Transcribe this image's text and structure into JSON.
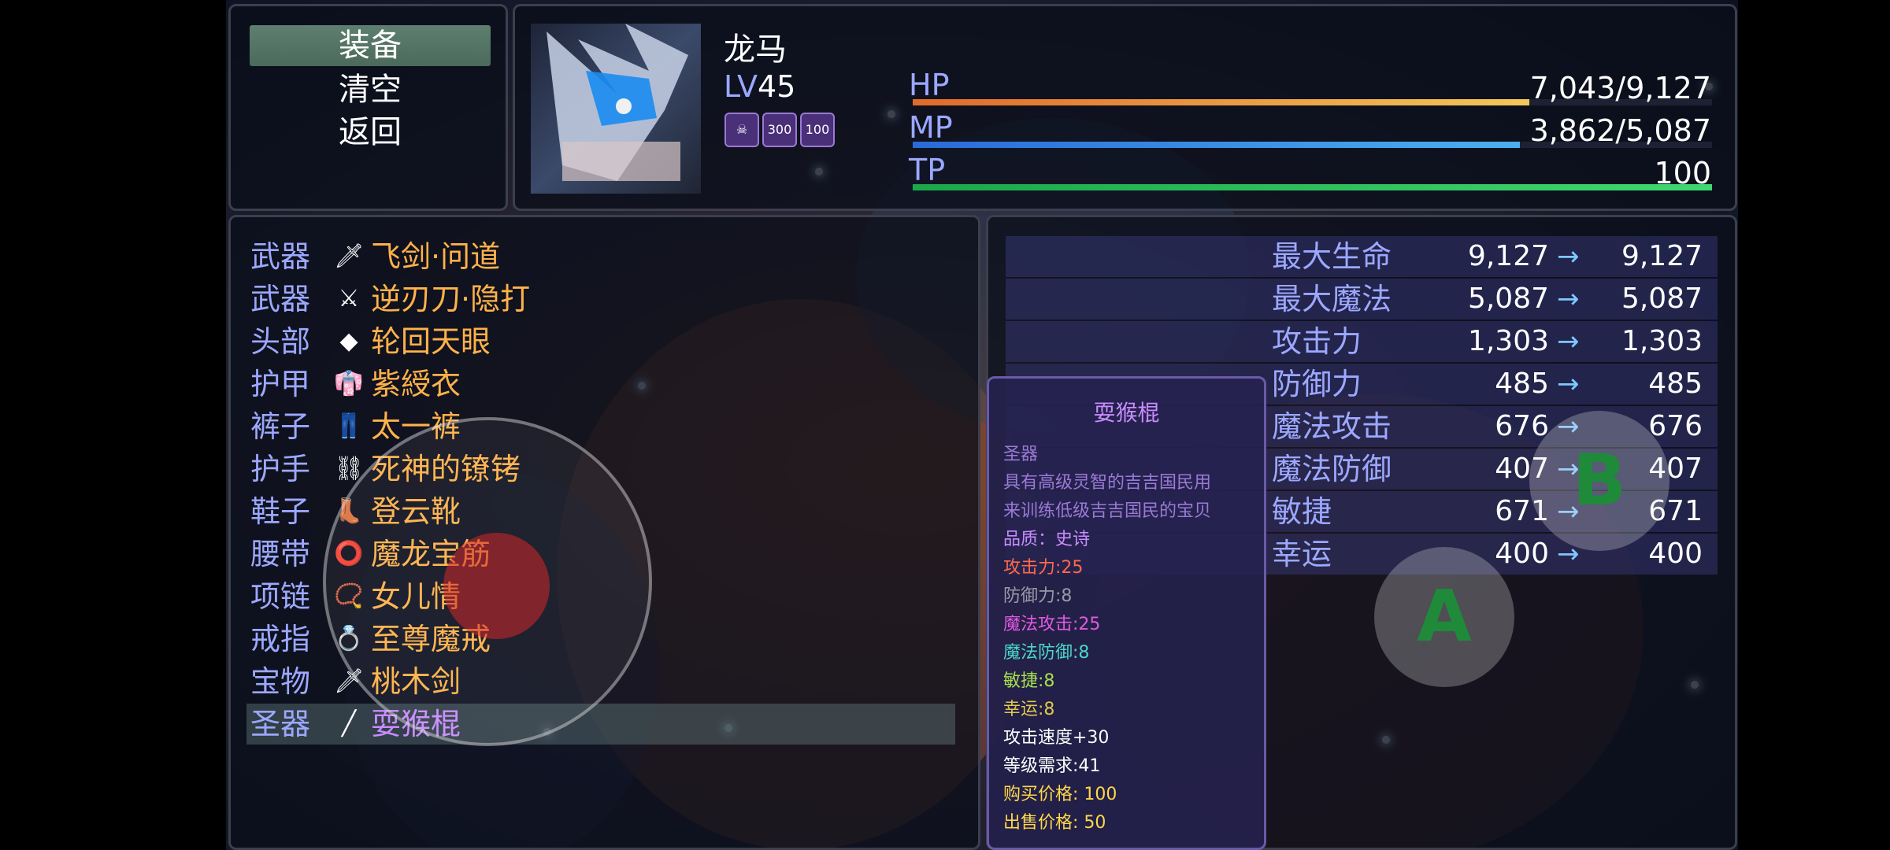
{
  "menu": {
    "items": [
      "装备",
      "清空",
      "返回"
    ],
    "selected_index": 0
  },
  "actor": {
    "name": "龙马",
    "level_prefix": "LV",
    "level": "45",
    "state_icons": [
      {
        "icon": "fang-mouth-icon",
        "text": ""
      },
      {
        "icon": "skull-300-icon",
        "text": "300"
      },
      {
        "icon": "shield-100-icon",
        "text": "100"
      }
    ],
    "gauges": [
      {
        "label": "HP",
        "value": "7,043/9,127",
        "fill": 0.7717,
        "color_from": "#e06a2a",
        "color_to": "#f2c85a"
      },
      {
        "label": "MP",
        "value": "3,862/5,087",
        "fill": 0.7592,
        "color_from": "#2a6ad8",
        "color_to": "#4ab0f0"
      },
      {
        "label": "TP",
        "value": "100",
        "fill": 1.0,
        "color_from": "#1aa84a",
        "color_to": "#3ed870"
      }
    ]
  },
  "slots": [
    {
      "type": "武器",
      "icon": "flying-sword-icon",
      "glyph": "🗡",
      "item": "飞剑·问道"
    },
    {
      "type": "武器",
      "icon": "reverse-blade-icon",
      "glyph": "⚔",
      "item": "逆刃刀·隐打"
    },
    {
      "type": "头部",
      "icon": "eye-gem-icon",
      "glyph": "◆",
      "item": "轮回天眼"
    },
    {
      "type": "护甲",
      "icon": "robe-icon",
      "glyph": "👘",
      "item": "紫綬衣"
    },
    {
      "type": "裤子",
      "icon": "pants-icon",
      "glyph": "👖",
      "item": "太一裤"
    },
    {
      "type": "护手",
      "icon": "shackles-icon",
      "glyph": "⛓",
      "item": "死神的镣铐"
    },
    {
      "type": "鞋子",
      "icon": "boot-icon",
      "glyph": "👢",
      "item": "登云靴"
    },
    {
      "type": "腰带",
      "icon": "belt-icon",
      "glyph": "⭕",
      "item": "魔龙宝筋"
    },
    {
      "type": "项链",
      "icon": "necklace-icon",
      "glyph": "📿",
      "item": "女儿情"
    },
    {
      "type": "戒指",
      "icon": "ring-icon",
      "glyph": "💍",
      "item": "至尊魔戒"
    },
    {
      "type": "宝物",
      "icon": "peach-sword-icon",
      "glyph": "🗡",
      "item": "桃木剑"
    },
    {
      "type": "圣器",
      "icon": "staff-icon",
      "glyph": "╱",
      "item": "耍猴棍"
    }
  ],
  "selected_slot": 11,
  "params": [
    {
      "name": "最大生命",
      "current": "9,127",
      "new": "9,127"
    },
    {
      "name": "最大魔法",
      "current": "5,087",
      "new": "5,087"
    },
    {
      "name": "攻击力",
      "current": "1,303",
      "new": "1,303"
    },
    {
      "name": "防御力",
      "current": "485",
      "new": "485"
    },
    {
      "name": "魔法攻击",
      "current": "676",
      "new": "676"
    },
    {
      "name": "魔法防御",
      "current": "407",
      "new": "407"
    },
    {
      "name": "敏捷",
      "current": "671",
      "new": "671"
    },
    {
      "name": "幸运",
      "current": "400",
      "new": "400"
    }
  ],
  "arrow_glyph": "→",
  "help": {
    "title": "耍猴棍",
    "lines": [
      {
        "text": "圣器",
        "color": "#9a7ad4"
      },
      {
        "text": "具有高级灵智的吉吉国民用",
        "color": "#9a7ad4"
      },
      {
        "text": "来训练低级吉吉国民的宝贝",
        "color": "#9a7ad4"
      },
      {
        "text": "品质：史诗",
        "color": "#c98cff"
      },
      {
        "text": "攻击力:25",
        "color": "#ff6a4a"
      },
      {
        "text": "防御力:8",
        "color": "#9a9aa8"
      },
      {
        "text": "魔法攻击:25",
        "color": "#e05ae0"
      },
      {
        "text": "魔法防御:8",
        "color": "#4ad8c8"
      },
      {
        "text": "敏捷:8",
        "color": "#a6e04a"
      },
      {
        "text": "幸运:8",
        "color": "#e0c84a"
      },
      {
        "text": "攻击速度+30",
        "color": "#ffffff"
      },
      {
        "text": "等级需求:41",
        "color": "#ffffff"
      },
      {
        "text": "购买价格: 100",
        "color": "#ffd84a"
      },
      {
        "text": "出售价格: 50",
        "color": "#ffd84a"
      }
    ]
  },
  "controls": {
    "button_b": "B",
    "button_a": "A"
  },
  "colors": {
    "system_blue": "#9ca8ff",
    "item_orange": "#ffb24a",
    "selected_purple": "#c98cff",
    "arrow_blue": "#7ec8ff"
  }
}
